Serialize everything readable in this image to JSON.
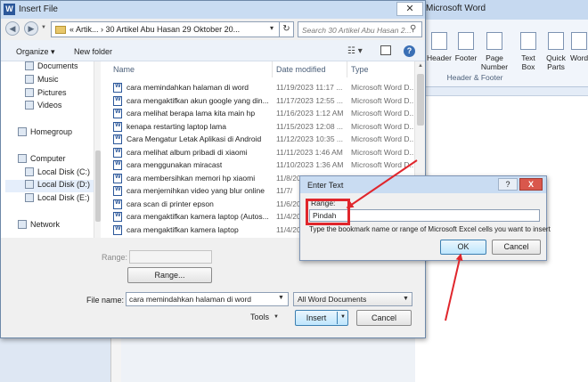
{
  "colors": {
    "accent": "#2b579a",
    "annotation_red": "#e0262c"
  },
  "word": {
    "title": "Microsoft Word",
    "ribbon_buttons": [
      {
        "label": "Header",
        "icon": "header-icon"
      },
      {
        "label": "Footer",
        "icon": "footer-icon"
      },
      {
        "label": "Page Number",
        "icon": "page-number-icon"
      },
      {
        "label": "Text Box",
        "icon": "text-box-icon"
      },
      {
        "label": "Quick Parts",
        "icon": "quick-parts-icon"
      },
      {
        "label": "Word",
        "icon": "wordart-icon"
      }
    ],
    "ribbon_group": "Header & Footer"
  },
  "insert_dialog": {
    "title": "Insert File",
    "address": {
      "path": "«  Artik... › 30 Artikel Abu Hasan 29 Oktober 20...",
      "icon": "folder-icon"
    },
    "search_placeholder": "Search 30 Artikel Abu Hasan 2...",
    "toolbar": {
      "organize": "Organize ▾",
      "new_folder": "New folder"
    },
    "nav_items": [
      {
        "label": "Documents",
        "icon": "documents-icon"
      },
      {
        "label": "Music",
        "icon": "music-icon"
      },
      {
        "label": "Pictures",
        "icon": "pictures-icon"
      },
      {
        "label": "Videos",
        "icon": "videos-icon"
      },
      {
        "label": "Homegroup",
        "icon": "homegroup-icon"
      },
      {
        "label": "Computer",
        "icon": "computer-icon"
      },
      {
        "label": "Local Disk (C:)",
        "icon": "drive-icon"
      },
      {
        "label": "Local Disk (D:)",
        "icon": "drive-icon"
      },
      {
        "label": "Local Disk (E:)",
        "icon": "drive-icon"
      },
      {
        "label": "Network",
        "icon": "network-icon"
      }
    ],
    "columns": {
      "name": "Name",
      "date": "Date modified",
      "type": "Type"
    },
    "files": [
      {
        "name": "cara memindahkan halaman di word",
        "date": "11/19/2023 11:17 ...",
        "type": "Microsoft Word D..."
      },
      {
        "name": "cara mengaktifkan akun google yang din...",
        "date": "11/17/2023 12:55 ...",
        "type": "Microsoft Word D..."
      },
      {
        "name": "cara melihat berapa lama kita main hp",
        "date": "11/16/2023 1:12 AM",
        "type": "Microsoft Word D..."
      },
      {
        "name": "kenapa restarting laptop lama",
        "date": "11/15/2023 12:08 ...",
        "type": "Microsoft Word D..."
      },
      {
        "name": "Cara Mengatur Letak Aplikasi di Android",
        "date": "11/12/2023 10:35 ...",
        "type": "Microsoft Word D..."
      },
      {
        "name": "cara melihat album pribadi di xiaomi",
        "date": "11/11/2023 1:46 AM",
        "type": "Microsoft Word D..."
      },
      {
        "name": "cara menggunakan miracast",
        "date": "11/10/2023 1:36 AM",
        "type": "Microsoft Word D..."
      },
      {
        "name": "cara membersihkan memori hp xiaomi",
        "date": "11/8/20",
        "type": ""
      },
      {
        "name": "cara menjernihkan video yang blur online",
        "date": "11/7/",
        "type": ""
      },
      {
        "name": "cara scan di printer epson",
        "date": "11/6/20",
        "type": ""
      },
      {
        "name": "cara mengaktifkan kamera laptop (Autos...",
        "date": "11/4/20",
        "type": ""
      },
      {
        "name": "cara mengaktifkan kamera laptop",
        "date": "11/4/20",
        "type": ""
      }
    ],
    "range_label": "Range:",
    "range_button": "Range...",
    "filename_label": "File name:",
    "filename_value": "cara memindahkan halaman di word",
    "filetype_value": "All Word Documents",
    "tools_label": "Tools",
    "insert_label": "Insert",
    "cancel_label": "Cancel"
  },
  "enter_text_dialog": {
    "title": "Enter Text",
    "range_label": "Range:",
    "input_value": "Pindah",
    "hint": "Type the bookmark name or range of Microsoft Excel cells you want to insert",
    "ok_label": "OK",
    "cancel_label": "Cancel",
    "help_label": "?",
    "close_label": "X"
  }
}
